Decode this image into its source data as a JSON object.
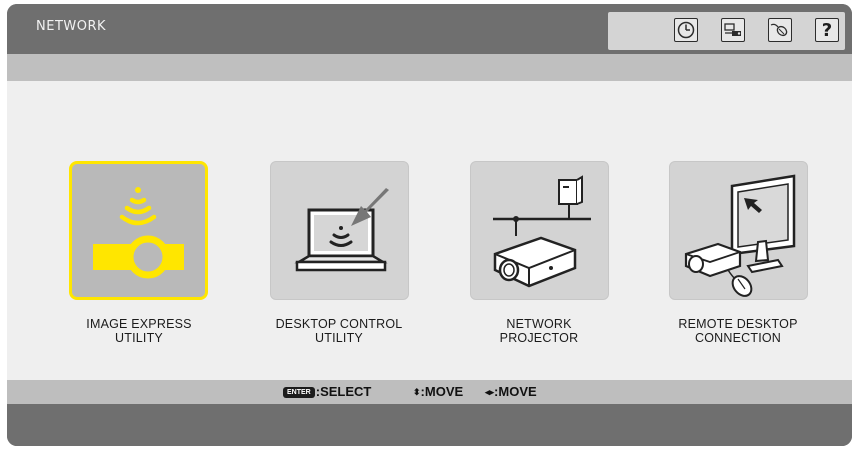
{
  "window": {
    "title": "NETWORK"
  },
  "toolbar_icons": [
    {
      "name": "clock-icon"
    },
    {
      "name": "input-source-icon"
    },
    {
      "name": "mouse-icon"
    },
    {
      "name": "help-icon",
      "glyph": "?"
    }
  ],
  "menu": {
    "items": [
      {
        "id": "image-express-utility",
        "line1": "IMAGE EXPRESS",
        "line2": "UTILITY",
        "icon": "wireless-projector-icon",
        "selected": true
      },
      {
        "id": "desktop-control-utility",
        "line1": "DESKTOP CONTROL",
        "line2": "UTILITY",
        "icon": "laptop-wireless-icon",
        "selected": false
      },
      {
        "id": "network-projector",
        "line1": "NETWORK",
        "line2": "PROJECTOR",
        "icon": "network-projector-icon",
        "selected": false
      },
      {
        "id": "remote-desktop-connection",
        "line1": "REMOTE DESKTOP",
        "line2": "CONNECTION",
        "icon": "remote-desktop-icon",
        "selected": false
      }
    ]
  },
  "status_hints": {
    "enter_key": "ENTER",
    "select": ":SELECT",
    "updown_glyph": "⬍",
    "move1": ":MOVE",
    "leftright_glyph": "◂▸",
    "move2": ":MOVE"
  },
  "colors": {
    "highlight": "#ffe600",
    "frame": "#6f6f6f",
    "content": "#efefef"
  }
}
